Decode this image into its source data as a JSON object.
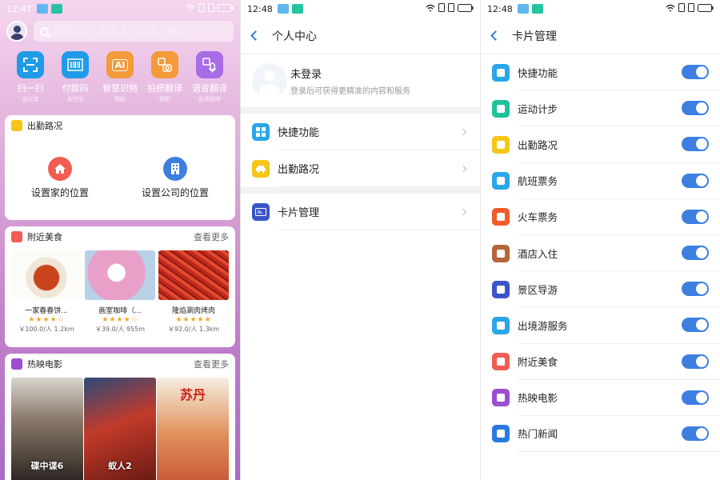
{
  "panel1": {
    "status_time": "12:47",
    "search_placeholder": "搜索应用、联系人、短信、网页...",
    "apps": [
      {
        "label": "扫一扫",
        "sub": "支付宝",
        "color": "#1f9be8",
        "icon": "scan-icon"
      },
      {
        "label": "付款码",
        "sub": "支付宝",
        "color": "#1f9be8",
        "icon": "barcode-icon"
      },
      {
        "label": "智慧识物",
        "sub": "相机",
        "color": "#f39a3b",
        "icon": "ai-camera-icon",
        "glyph": "AI"
      },
      {
        "label": "拍照翻译",
        "sub": "相机",
        "color": "#f39a3b",
        "icon": "photo-translate-icon"
      },
      {
        "label": "语音翻译",
        "sub": "应用程序",
        "color": "#a76ce6",
        "icon": "voice-translate-icon"
      }
    ],
    "commute": {
      "title": "出勤路况",
      "home": "设置家的位置",
      "company": "设置公司的位置"
    },
    "food": {
      "title": "附近美食",
      "more": "查看更多",
      "items": [
        {
          "name": "一家春春饼...",
          "stars": "★★★★☆",
          "meta": "￥100.0/人   1.2km"
        },
        {
          "name": "画室咖啡（...",
          "stars": "★★★★☆",
          "meta": "￥39.0/人   955m"
        },
        {
          "name": "隆焰涮肉烤肉",
          "stars": "★★★★★",
          "meta": "￥92.0/人   1.3km"
        }
      ]
    },
    "movie": {
      "title": "热映电影",
      "more": "查看更多",
      "items": [
        {
          "title": "碟中谍6"
        },
        {
          "title": "蚁人2"
        },
        {
          "title": "苏丹"
        }
      ]
    }
  },
  "panel2": {
    "status_time": "12:48",
    "title": "个人中心",
    "profile_name": "未登录",
    "profile_desc": "登录后可获得更精准的内容和服务",
    "rows": [
      {
        "label": "快捷功能",
        "color": "#2aa7e8",
        "icon": "shortcut-icon"
      },
      {
        "label": "出勤路况",
        "color": "#f5c518",
        "icon": "car-icon"
      },
      {
        "label": "卡片管理",
        "color": "#3b55c7",
        "icon": "card-icon"
      }
    ]
  },
  "panel3": {
    "status_time": "12:48",
    "title": "卡片管理",
    "items": [
      {
        "label": "快捷功能",
        "color": "#2aa7e8",
        "icon": "shortcut-icon"
      },
      {
        "label": "运动计步",
        "color": "#1fc29a",
        "icon": "shoe-icon"
      },
      {
        "label": "出勤路况",
        "color": "#f5c518",
        "icon": "car-icon"
      },
      {
        "label": "航班票务",
        "color": "#2aa7e8",
        "icon": "plane-icon"
      },
      {
        "label": "火车票务",
        "color": "#f25c2a",
        "icon": "train-icon"
      },
      {
        "label": "酒店入住",
        "color": "#b6653a",
        "icon": "hotel-icon"
      },
      {
        "label": "景区导游",
        "color": "#3b55c7",
        "icon": "landmark-icon"
      },
      {
        "label": "出境游服务",
        "color": "#2aa7e8",
        "icon": "globe-icon"
      },
      {
        "label": "附近美食",
        "color": "#f25c52",
        "icon": "food-icon"
      },
      {
        "label": "热映电影",
        "color": "#9c4ed1",
        "icon": "film-icon"
      },
      {
        "label": "热门新闻",
        "color": "#2a7ae2",
        "icon": "news-icon"
      }
    ]
  }
}
